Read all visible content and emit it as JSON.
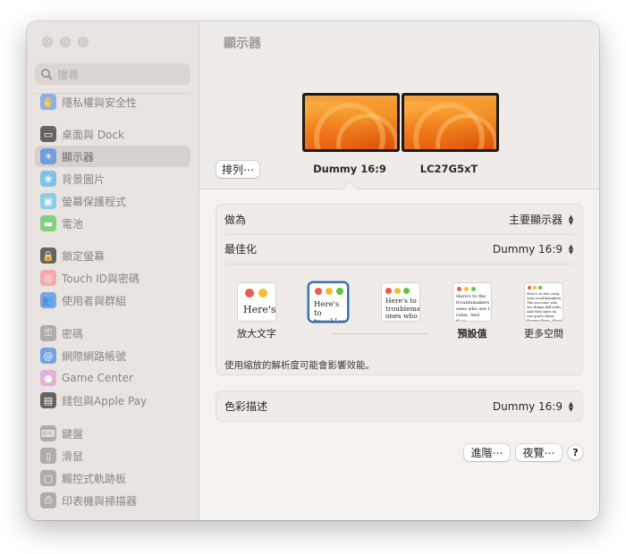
{
  "window": {
    "title": "顯示器"
  },
  "sidebar": {
    "search_placeholder": "搜尋",
    "items": [
      {
        "label": "隱私權與安全性",
        "icon": "hand-icon",
        "color": "#6aa0e6"
      },
      {
        "label": "桌面與 Dock",
        "icon": "dock-icon",
        "color": "#3b3b3b"
      },
      {
        "label": "顯示器",
        "icon": "sun-icon",
        "color": "#4f8de0",
        "selected": true
      },
      {
        "label": "背景圖片",
        "icon": "wallpaper-icon",
        "color": "#5fb8e8"
      },
      {
        "label": "螢幕保護程式",
        "icon": "screensaver-icon",
        "color": "#6ec6e8"
      },
      {
        "label": "電池",
        "icon": "battery-icon",
        "color": "#60c860"
      },
      {
        "label": "鎖定螢幕",
        "icon": "lock-icon",
        "color": "#3a3a3a"
      },
      {
        "label": "Touch ID與密碼",
        "icon": "fingerprint-icon",
        "color": "#f19a9a"
      },
      {
        "label": "使用者與群組",
        "icon": "users-icon",
        "color": "#5a90e0"
      },
      {
        "label": "密碼",
        "icon": "key-icon",
        "color": "#9a9a9a"
      },
      {
        "label": "網際網路帳號",
        "icon": "at-icon",
        "color": "#4f8de0"
      },
      {
        "label": "Game Center",
        "icon": "game-center-icon",
        "color": "#e4a0d8"
      },
      {
        "label": "錢包與Apple Pay",
        "icon": "wallet-icon",
        "color": "#3a3a3a"
      },
      {
        "label": "鍵盤",
        "icon": "keyboard-icon",
        "color": "#9a9a9a"
      },
      {
        "label": "滑鼠",
        "icon": "mouse-icon",
        "color": "#9a9a9a"
      },
      {
        "label": "觸控式軌跡板",
        "icon": "trackpad-icon",
        "color": "#9a9a9a"
      },
      {
        "label": "印表機與掃描器",
        "icon": "printer-icon",
        "color": "#9a9a9a"
      }
    ]
  },
  "displays": {
    "arrange_button": "排列⋯",
    "monitors": [
      {
        "name": "Dummy 16:9",
        "selected": true
      },
      {
        "name": "LC27G5xT",
        "selected": false
      }
    ]
  },
  "settings": {
    "use_as": {
      "label": "做為",
      "value": "主要顯示器"
    },
    "optimize": {
      "label": "最佳化",
      "value": "Dummy 16:9"
    },
    "resolutions": [
      {
        "sample": "Here's",
        "label": "放大文字",
        "selected": false
      },
      {
        "sample": "Here's to troublem",
        "label": "",
        "selected": true
      },
      {
        "sample": "Here's to troublema ones who",
        "label": "",
        "selected": false
      },
      {
        "sample": "Here's to the troublemakers ones who see t rules. And they",
        "label": "預設值",
        "selected": false
      },
      {
        "sample": "Here's to the crazy ones troublemakers. The rou ones who see things diff rules. And they have no can quote them, disagre them. About the only thi Because they change thi",
        "label": "更多空間",
        "selected": false
      }
    ],
    "scaling_note": "使用縮放的解析度可能會影響效能。",
    "color_profile": {
      "label": "色彩描述",
      "value": "Dummy 16:9"
    }
  },
  "footer": {
    "advanced_button": "進階⋯",
    "night_shift_button": "夜覽⋯",
    "help_button": "?"
  }
}
